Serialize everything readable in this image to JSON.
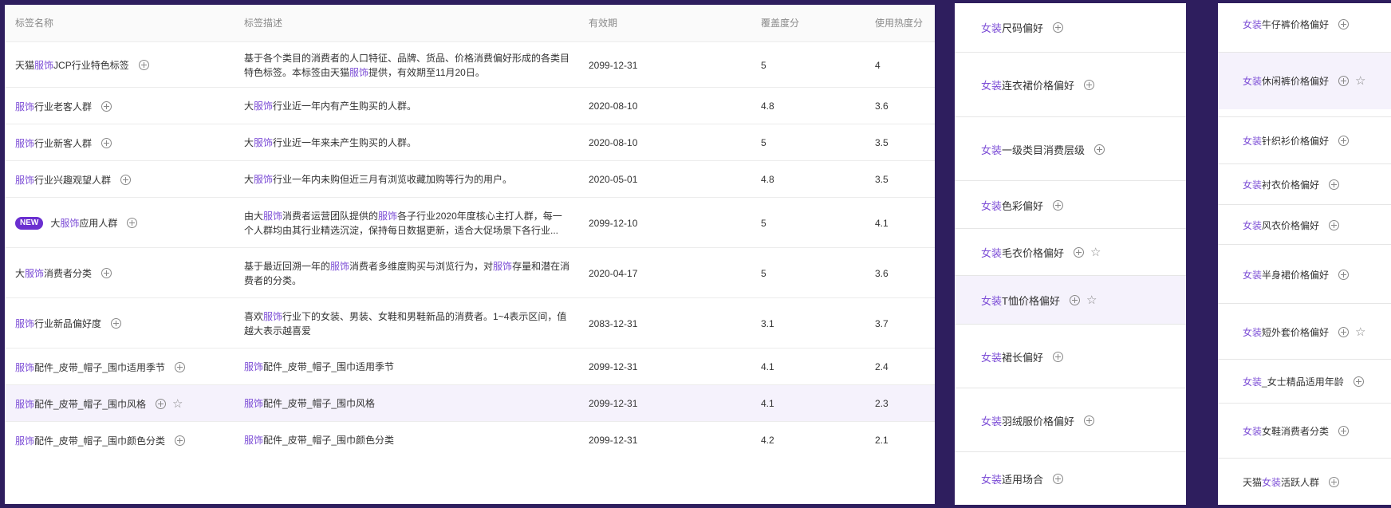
{
  "table": {
    "headers": {
      "name": "标签名称",
      "desc": "标签描述",
      "date": "有效期",
      "coverage": "覆盖度分",
      "heat": "使用热度分"
    },
    "rows": [
      {
        "name_pre": "天猫",
        "name_hl": "服饰",
        "name_post": "JCP行业特色标签",
        "badge": "",
        "desc_parts": [
          "基于各个类目的消费者的人口特征、品牌、货品、价格消费偏好形成的各类目特色标签。本标签由天猫",
          "服饰",
          "提供，有效期至11月20日。"
        ],
        "date": "2099-12-31",
        "coverage": "5",
        "heat": "4",
        "star": false
      },
      {
        "name_pre": "",
        "name_hl": "服饰",
        "name_post": "行业老客人群",
        "badge": "",
        "desc_parts": [
          "大",
          "服饰",
          "行业近一年内有产生购买的人群。"
        ],
        "date": "2020-08-10",
        "coverage": "4.8",
        "heat": "3.6",
        "star": false
      },
      {
        "name_pre": "",
        "name_hl": "服饰",
        "name_post": "行业新客人群",
        "badge": "",
        "desc_parts": [
          "大",
          "服饰",
          "行业近一年来未产生购买的人群。"
        ],
        "date": "2020-08-10",
        "coverage": "5",
        "heat": "3.5",
        "star": false
      },
      {
        "name_pre": "",
        "name_hl": "服饰",
        "name_post": "行业兴趣观望人群",
        "badge": "",
        "desc_parts": [
          "大",
          "服饰",
          "行业一年内未购但近三月有浏览收藏加购等行为的用户。"
        ],
        "date": "2020-05-01",
        "coverage": "4.8",
        "heat": "3.5",
        "star": false
      },
      {
        "name_pre": "大",
        "name_hl": "服饰",
        "name_post": "应用人群",
        "badge": "NEW",
        "desc_parts": [
          "由大",
          "服饰",
          "消费者运营团队提供的",
          "服饰",
          "各子行业2020年度核心主打人群，每一个人群均由其行业精选沉淀，保持每日数据更新，适合大促场景下各行业..."
        ],
        "date": "2099-12-10",
        "coverage": "5",
        "heat": "4.1",
        "star": false
      },
      {
        "name_pre": "大",
        "name_hl": "服饰",
        "name_post": "消费者分类",
        "badge": "",
        "desc_parts": [
          "基于最近回溯一年的",
          "服饰",
          "消费者多维度购买与浏览行为，对",
          "服饰",
          "存量和潜在消费者的分类。"
        ],
        "date": "2020-04-17",
        "coverage": "5",
        "heat": "3.6",
        "star": false
      },
      {
        "name_pre": "",
        "name_hl": "服饰",
        "name_post": "行业新品偏好度",
        "badge": "",
        "desc_parts": [
          "喜欢",
          "服饰",
          "行业下的女装、男装、女鞋和男鞋新品的消费者。1~4表示区间，值越大表示越喜爱"
        ],
        "date": "2083-12-31",
        "coverage": "3.1",
        "heat": "3.7",
        "star": false
      },
      {
        "name_pre": "",
        "name_hl": "服饰",
        "name_post": "配件_皮带_帽子_围巾适用季节",
        "badge": "",
        "desc_parts": [
          "",
          "服饰",
          "配件_皮带_帽子_围巾适用季节"
        ],
        "date": "2099-12-31",
        "coverage": "4.1",
        "heat": "2.4",
        "star": false
      },
      {
        "name_pre": "",
        "name_hl": "服饰",
        "name_post": "配件_皮带_帽子_围巾风格",
        "badge": "",
        "desc_parts": [
          "",
          "服饰",
          "配件_皮带_帽子_围巾风格"
        ],
        "date": "2099-12-31",
        "coverage": "4.1",
        "heat": "2.3",
        "star": true
      },
      {
        "name_pre": "",
        "name_hl": "服饰",
        "name_post": "配件_皮带_帽子_围巾颜色分类",
        "badge": "",
        "desc_parts": [
          "",
          "服饰",
          "配件_皮带_帽子_围巾颜色分类"
        ],
        "date": "2099-12-31",
        "coverage": "4.2",
        "heat": "2.1",
        "star": false
      }
    ]
  },
  "mid_list": [
    {
      "pre": "",
      "hl": "女装",
      "post": "尺码偏好",
      "star": false
    },
    {
      "pre": "",
      "hl": "女装",
      "post": "连衣裙价格偏好",
      "star": false
    },
    {
      "pre": "",
      "hl": "女装",
      "post": "一级类目消费层级",
      "star": false
    },
    {
      "pre": "",
      "hl": "女装",
      "post": "色彩偏好",
      "star": false
    },
    {
      "pre": "",
      "hl": "女装",
      "post": "毛衣价格偏好",
      "star": true
    },
    {
      "pre": "",
      "hl": "女装",
      "post": "T恤价格偏好",
      "star": true
    },
    {
      "pre": "",
      "hl": "女装",
      "post": "裙长偏好",
      "star": false
    },
    {
      "pre": "",
      "hl": "女装",
      "post": "羽绒服价格偏好",
      "star": false
    },
    {
      "pre": "",
      "hl": "女装",
      "post": "适用场合",
      "star": false
    }
  ],
  "right_list": [
    {
      "pre": "",
      "hl": "女装",
      "post": "牛仔裤价格偏好",
      "star": false
    },
    {
      "pre": "",
      "hl": "女装",
      "post": "休闲裤价格偏好",
      "star": true
    },
    {
      "pre": "",
      "hl": "女装",
      "post": "针织衫价格偏好",
      "star": false
    },
    {
      "pre": "",
      "hl": "女装",
      "post": "衬衣价格偏好",
      "star": false
    },
    {
      "pre": "",
      "hl": "女装",
      "post": "风衣价格偏好",
      "star": false
    },
    {
      "pre": "",
      "hl": "女装",
      "post": "半身裙价格偏好",
      "star": false
    },
    {
      "pre": "",
      "hl": "女装",
      "post": "短外套价格偏好",
      "star": true
    },
    {
      "pre": "",
      "hl": "女装",
      "post": "_女士精品适用年龄",
      "star": false
    },
    {
      "pre": "",
      "hl": "女装",
      "post": "女鞋消费者分类",
      "star": false
    },
    {
      "pre": "天猫",
      "hl": "女装",
      "post": "活跃人群",
      "star": false
    }
  ],
  "colors": {
    "accent": "#7c4dd6",
    "background": "#2e1e5e",
    "highlight_row": "#f5f2fc",
    "badge": "#6a2fd0"
  },
  "icons": {
    "add": "plus-circle-icon",
    "favorite": "star-outline-icon"
  }
}
